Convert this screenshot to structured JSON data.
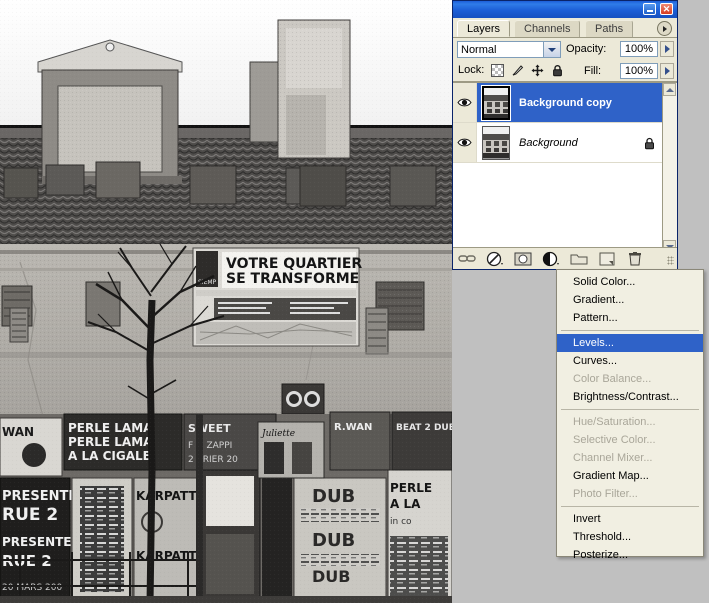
{
  "app": {
    "background_color": "#c0c0c0",
    "accent_blue": "#2f62c8",
    "titlebar_blue": "#1d5ed8"
  },
  "photo": {
    "name": "building-facade-photo",
    "mode": "black-and-white",
    "billboard_line1": "VOTRE QUARTIER",
    "billboard_line2": "SE TRANSFORME",
    "billboard_badge": "SIEMP",
    "posters": [
      "PERLE LAMA",
      "A LA CIGALE",
      "KARPATT",
      "PRESENTE RUE 2",
      "DUB",
      "R.WAN",
      "Juliette",
      "BEAT 2 DUB",
      "F + ZAPPI"
    ]
  },
  "palette": {
    "titlebar": {
      "minimize_label": "Minimize",
      "close_label": "Close"
    },
    "tabs": [
      {
        "label": "Layers",
        "active": true
      },
      {
        "label": "Channels",
        "active": false
      },
      {
        "label": "Paths",
        "active": false
      }
    ],
    "flyout_label": "Palette menu",
    "blend_mode": "Normal",
    "opacity_label": "Opacity:",
    "opacity_value": "100%",
    "lock_label": "Lock:",
    "lock_icons": [
      "lock-transparent-pixels-icon",
      "lock-image-pixels-icon",
      "lock-position-icon",
      "lock-all-icon"
    ],
    "fill_label": "Fill:",
    "fill_value": "100%",
    "layers": [
      {
        "name": "Background copy",
        "selected": true,
        "locked": false,
        "visible": true,
        "italic": false
      },
      {
        "name": "Background",
        "selected": false,
        "locked": true,
        "visible": true,
        "italic": true
      }
    ],
    "bottom_icons": [
      "link-layers-icon",
      "layer-style-fx-icon",
      "add-layer-mask-icon",
      "new-fill-adjustment-layer-icon",
      "new-group-icon",
      "new-layer-icon",
      "delete-layer-icon"
    ]
  },
  "menu": {
    "name": "new-fill-adjustment-layer-menu",
    "items": [
      {
        "label": "Solid Color...",
        "type": "item",
        "state": "normal"
      },
      {
        "label": "Gradient...",
        "type": "item",
        "state": "normal"
      },
      {
        "label": "Pattern...",
        "type": "item",
        "state": "normal"
      },
      {
        "label": "",
        "type": "separator"
      },
      {
        "label": "Levels...",
        "type": "item",
        "state": "highlighted"
      },
      {
        "label": "Curves...",
        "type": "item",
        "state": "normal"
      },
      {
        "label": "Color Balance...",
        "type": "item",
        "state": "disabled"
      },
      {
        "label": "Brightness/Contrast...",
        "type": "item",
        "state": "normal"
      },
      {
        "label": "",
        "type": "separator"
      },
      {
        "label": "Hue/Saturation...",
        "type": "item",
        "state": "disabled"
      },
      {
        "label": "Selective Color...",
        "type": "item",
        "state": "disabled"
      },
      {
        "label": "Channel Mixer...",
        "type": "item",
        "state": "disabled"
      },
      {
        "label": "Gradient Map...",
        "type": "item",
        "state": "normal"
      },
      {
        "label": "Photo Filter...",
        "type": "item",
        "state": "disabled"
      },
      {
        "label": "",
        "type": "separator"
      },
      {
        "label": "Invert",
        "type": "item",
        "state": "normal"
      },
      {
        "label": "Threshold...",
        "type": "item",
        "state": "normal"
      },
      {
        "label": "Posterize...",
        "type": "item",
        "state": "normal"
      }
    ]
  }
}
